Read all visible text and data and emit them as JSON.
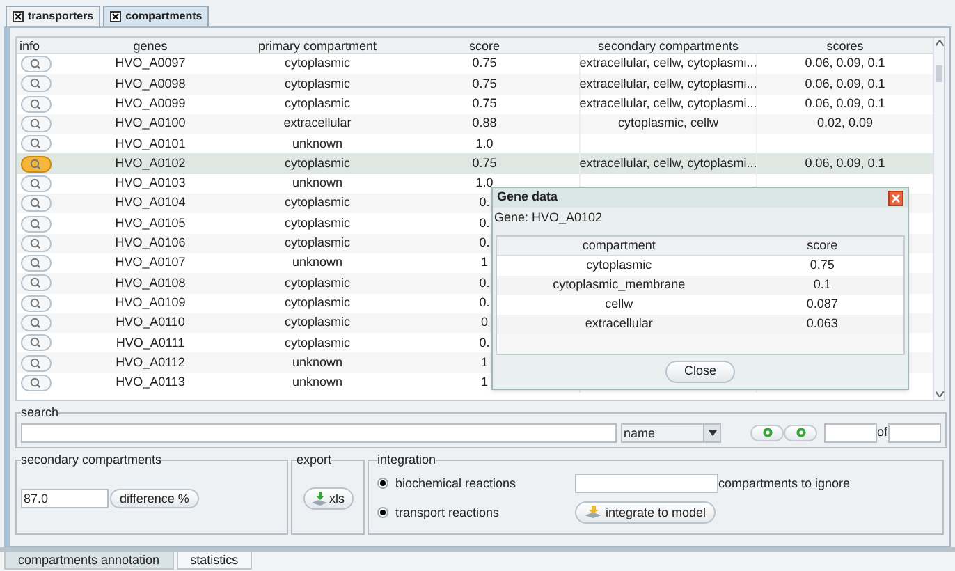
{
  "tabs": [
    {
      "label": "transporters",
      "selected": false
    },
    {
      "label": "compartments",
      "selected": true
    }
  ],
  "table": {
    "columns": [
      "info",
      "genes",
      "primary compartment",
      "score",
      "secondary compartments",
      "scores"
    ],
    "rows": [
      {
        "gene": "HVO_A0097",
        "primary": "cytoplasmic",
        "score": "0.75",
        "secondary": "extracellular, cellw, cytoplasmi...",
        "scores": "0.06, 0.09, 0.1",
        "selected": false
      },
      {
        "gene": "HVO_A0098",
        "primary": "cytoplasmic",
        "score": "0.75",
        "secondary": "extracellular, cellw, cytoplasmi...",
        "scores": "0.06, 0.09, 0.1",
        "selected": false
      },
      {
        "gene": "HVO_A0099",
        "primary": "cytoplasmic",
        "score": "0.75",
        "secondary": "extracellular, cellw, cytoplasmi...",
        "scores": "0.06, 0.09, 0.1",
        "selected": false
      },
      {
        "gene": "HVO_A0100",
        "primary": "extracellular",
        "score": "0.88",
        "secondary": "cytoplasmic, cellw",
        "scores": "0.02, 0.09",
        "selected": false
      },
      {
        "gene": "HVO_A0101",
        "primary": "unknown",
        "score": "1.0",
        "selected": false
      },
      {
        "gene": "HVO_A0102",
        "primary": "cytoplasmic",
        "score": "0.75",
        "secondary": "extracellular, cellw, cytoplasmi...",
        "scores": "0.06, 0.09, 0.1",
        "selected": true
      },
      {
        "gene": "HVO_A0103",
        "primary": "unknown",
        "score": "1.0",
        "selected": false
      },
      {
        "gene": "HVO_A0104",
        "primary": "cytoplasmic",
        "score": "0.",
        "selected": false
      },
      {
        "gene": "HVO_A0105",
        "primary": "cytoplasmic",
        "score": "0.",
        "selected": false
      },
      {
        "gene": "HVO_A0106",
        "primary": "cytoplasmic",
        "score": "0.",
        "selected": false
      },
      {
        "gene": "HVO_A0107",
        "primary": "unknown",
        "score": "1",
        "selected": false
      },
      {
        "gene": "HVO_A0108",
        "primary": "cytoplasmic",
        "score": "0.",
        "selected": false
      },
      {
        "gene": "HVO_A0109",
        "primary": "cytoplasmic",
        "score": "0.",
        "selected": false
      },
      {
        "gene": "HVO_A0110",
        "primary": "cytoplasmic",
        "score": "0",
        "selected": false
      },
      {
        "gene": "HVO_A0111",
        "primary": "cytoplasmic",
        "score": "0.",
        "selected": false
      },
      {
        "gene": "HVO_A0112",
        "primary": "unknown",
        "score": "1",
        "selected": false
      },
      {
        "gene": "HVO_A0113",
        "primary": "unknown",
        "score": "1",
        "selected": false
      }
    ]
  },
  "dialog": {
    "title": "Gene data",
    "gene": "Gene: HVO_A0102",
    "columns": [
      "compartment",
      "score"
    ],
    "rows": [
      [
        "cytoplasmic",
        "0.75"
      ],
      [
        "cytoplasmic_membrane",
        "0.1"
      ],
      [
        "cellw",
        "0.087"
      ],
      [
        "extracellular",
        "0.063"
      ]
    ],
    "button": "Close"
  },
  "search": {
    "label": "search",
    "dropdown": "name",
    "of_label": "of"
  },
  "secondary_compartments": {
    "label": "secondary compartments",
    "value": "87.0",
    "button": "difference %"
  },
  "export": {
    "label": "export",
    "button": "xls"
  },
  "integration": {
    "label": "integration",
    "options": [
      {
        "label": "biochemical reactions",
        "checked": true
      },
      {
        "label": "transport reactions",
        "checked": true
      }
    ],
    "ignore_label": "compartments to ignore",
    "button": "integrate to model"
  },
  "bottom_tabs": [
    {
      "label": "compartments annotation",
      "selected": true
    },
    {
      "label": "statistics",
      "selected": false
    }
  ]
}
